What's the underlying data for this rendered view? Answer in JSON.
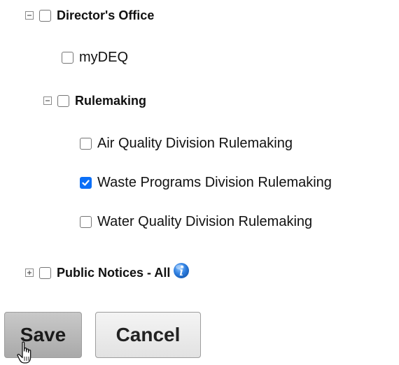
{
  "tree": {
    "directors_office": {
      "label": "Director's Office",
      "expander": "collapse-icon",
      "checked": false
    },
    "mydeq": {
      "label": "myDEQ",
      "checked": false
    },
    "rulemaking": {
      "label": "Rulemaking",
      "expander": "collapse-icon",
      "checked": false
    },
    "air_quality": {
      "label": "Air Quality Division Rulemaking",
      "checked": false
    },
    "waste_programs": {
      "label": "Waste Programs Division Rulemaking",
      "checked": true
    },
    "water_quality": {
      "label": "Water Quality Division Rulemaking",
      "checked": false
    },
    "public_notices": {
      "label": "Public Notices - All",
      "expander": "expand-icon",
      "checked": false,
      "info_icon": "info-icon"
    }
  },
  "buttons": {
    "save_label": "Save",
    "cancel_label": "Cancel"
  },
  "colors": {
    "checkbox_checked": "#0b6ff7",
    "info_icon": "#2f7fe0"
  },
  "cursor": "hand-pointer-icon"
}
